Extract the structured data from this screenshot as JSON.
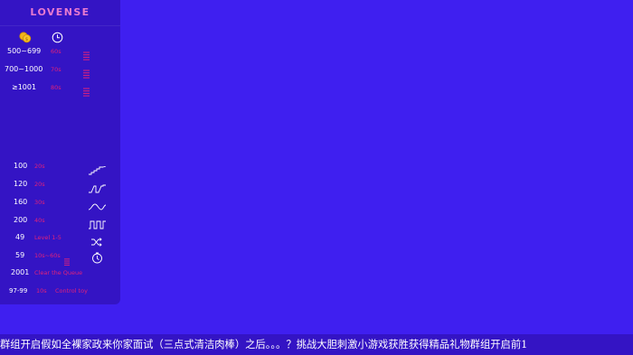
{
  "panel": {
    "logo": "LOVENSE",
    "header": {
      "coin_icon": "coins-icon",
      "timer_icon": "clock-icon"
    },
    "tiers": [
      {
        "range": "500~699",
        "duration": "60s",
        "icon": "list-icon"
      },
      {
        "range": "700~1000",
        "duration": "70s",
        "icon": "list-icon"
      },
      {
        "range": "≥1001",
        "duration": "80s",
        "icon": "list-icon"
      }
    ],
    "specials": [
      {
        "tokens": "100",
        "action": "20s",
        "icon": "wave-pattern-icon"
      },
      {
        "tokens": "120",
        "action": "20s",
        "icon": "pulse-pattern-icon"
      },
      {
        "tokens": "160",
        "action": "30s",
        "icon": "sine-pattern-icon"
      },
      {
        "tokens": "200",
        "action": "40s",
        "icon": "square-pattern-icon"
      },
      {
        "tokens": "49",
        "action": "Level 1-5",
        "icon": "shuffle-icon"
      },
      {
        "tokens": "59",
        "action": "10s~60s",
        "icon": "random-timer-icon"
      },
      {
        "tokens": "2001",
        "action": "Clear the Queue",
        "icon": ""
      },
      {
        "tokens": "97-99",
        "action": "10s",
        "extra": "Control toy",
        "icon": ""
      }
    ]
  },
  "footer": {
    "marquee": "群组开启假如全裸家政来你家面试（三点式清洁肉棒）之后。。。？挑战大胆刺激小游戏获胜获得精品礼物群组开启前1"
  },
  "colors": {
    "background": "#3f1ff0",
    "panel": "#3414c4",
    "accent_pink": "#e0227a",
    "logo_pink": "#e77ad0"
  }
}
